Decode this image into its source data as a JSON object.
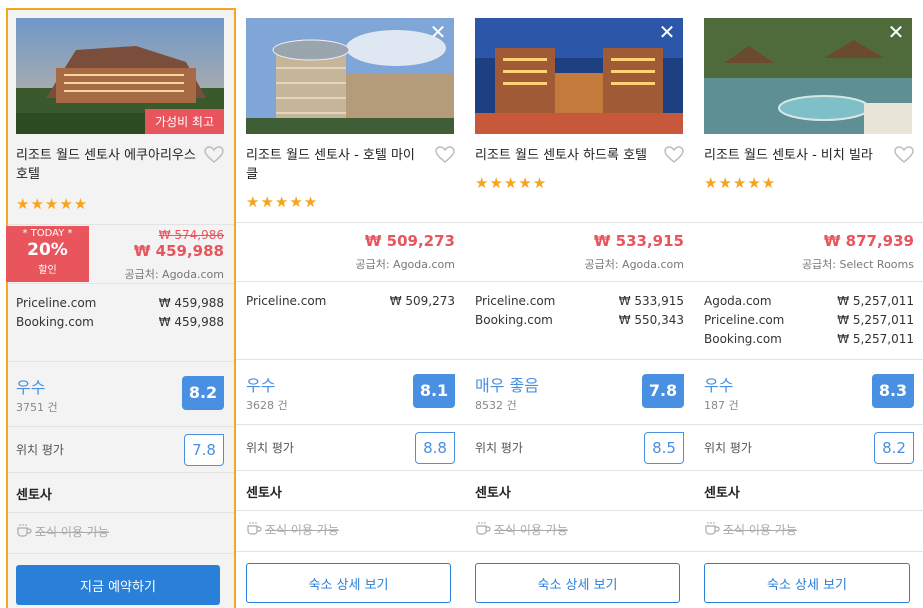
{
  "colors": {
    "accent": "#2a7fd9",
    "price_red": "#e8555d",
    "star": "#f7a41d",
    "highlight_border": "#f5a623",
    "score_blue": "#4a90e2"
  },
  "hotels": [
    {
      "name": "리조트 월드 센토사 에쿠아리우스 호텔",
      "badge": "가성비 최고",
      "stars": "★★★★★",
      "today": {
        "label": "* TODAY *",
        "discount": "20%",
        "suffix": "할인"
      },
      "old_price": "₩ 574,986",
      "price": "₩ 459,988",
      "source": "공급처: Agoda.com",
      "offers": [
        {
          "site": "Priceline.com",
          "price": "₩ 459,988"
        },
        {
          "site": "Booking.com",
          "price": "₩ 459,988"
        }
      ],
      "rating_label": "우수",
      "review_count": "3751 건",
      "score": "8.2",
      "location_label": "위치 평가",
      "location_score": "7.8",
      "area": "센토사",
      "breakfast": "조식 이용 가능",
      "cta": "지금 예약하기"
    },
    {
      "name": "리조트 월드 센토사 - 호텔 마이클",
      "stars": "★★★★★",
      "price": "₩ 509,273",
      "source": "공급처: Agoda.com",
      "offers": [
        {
          "site": "Priceline.com",
          "price": "₩ 509,273"
        }
      ],
      "rating_label": "우수",
      "review_count": "3628 건",
      "score": "8.1",
      "location_label": "위치 평가",
      "location_score": "8.8",
      "area": "센토사",
      "breakfast": "조식 이용 가능",
      "cta": "숙소 상세 보기"
    },
    {
      "name": "리조트 월드 센토사 하드록 호텔",
      "stars": "★★★★★",
      "price": "₩ 533,915",
      "source": "공급처: Agoda.com",
      "offers": [
        {
          "site": "Priceline.com",
          "price": "₩ 533,915"
        },
        {
          "site": "Booking.com",
          "price": "₩ 550,343"
        }
      ],
      "rating_label": "매우 좋음",
      "review_count": "8532 건",
      "score": "7.8",
      "location_label": "위치 평가",
      "location_score": "8.5",
      "area": "센토사",
      "breakfast": "조식 이용 가능",
      "cta": "숙소 상세 보기"
    },
    {
      "name": "리조트 월드 센토사 - 비치 빌라",
      "stars": "★★★★★",
      "price": "₩ 877,939",
      "source": "공급처: Select Rooms",
      "offers": [
        {
          "site": "Agoda.com",
          "price": "₩ 5,257,011"
        },
        {
          "site": "Priceline.com",
          "price": "₩ 5,257,011"
        },
        {
          "site": "Booking.com",
          "price": "₩ 5,257,011"
        }
      ],
      "rating_label": "우수",
      "review_count": "187 건",
      "score": "8.3",
      "location_label": "위치 평가",
      "location_score": "8.2",
      "area": "센토사",
      "breakfast": "조식 이용 가능",
      "cta": "숙소 상세 보기"
    }
  ],
  "icons": {
    "close": "close-icon",
    "heart": "heart-outline-icon",
    "breakfast": "coffee-cup-icon",
    "star": "star-icon"
  }
}
